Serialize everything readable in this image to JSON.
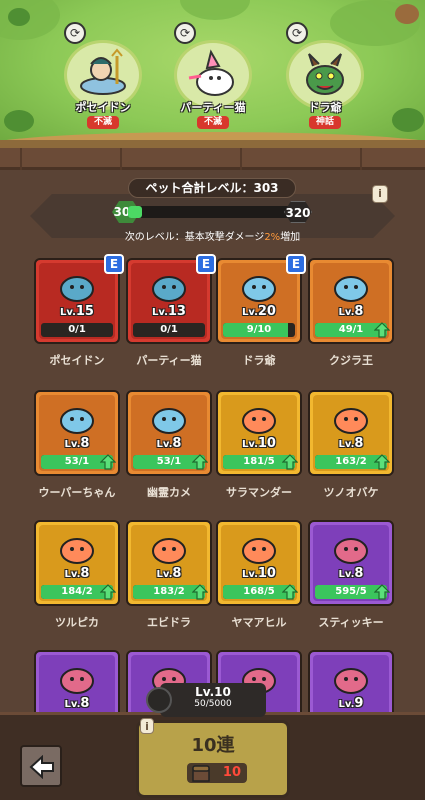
{
  "team": [
    {
      "name": "ポセイドン",
      "tag": "不滅",
      "tag_color": "#d8382c"
    },
    {
      "name": "パーティー猫",
      "tag": "不滅",
      "tag_color": "#d8382c"
    },
    {
      "name": "ドラ爺",
      "tag": "神話",
      "tag_color": "#d8382c"
    }
  ],
  "pet_level": {
    "title": "ペット合計レベル：303",
    "current": "300",
    "next": "320",
    "progress": 0.08,
    "next_bonus_prefix": "次のレベル：基本攻撃ダメージ",
    "next_bonus_value": "2%",
    "next_bonus_suffix": "増加",
    "info": "i"
  },
  "pets": [
    {
      "name": "ポセイドン",
      "level": "15",
      "count": "0/1",
      "progress": 0.0,
      "rarity": "red",
      "equipped": true,
      "upgradable": false
    },
    {
      "name": "パーティー猫",
      "level": "13",
      "count": "0/1",
      "progress": 0.0,
      "rarity": "red",
      "equipped": true,
      "upgradable": false
    },
    {
      "name": "ドラ爺",
      "level": "20",
      "count": "9/10",
      "progress": 0.9,
      "rarity": "orange",
      "equipped": true,
      "upgradable": false
    },
    {
      "name": "クジラ王",
      "level": "8",
      "count": "49/1",
      "progress": 1.0,
      "rarity": "orange",
      "equipped": false,
      "upgradable": true
    },
    {
      "name": "ウーパーちゃん",
      "level": "8",
      "count": "53/1",
      "progress": 1.0,
      "rarity": "orange",
      "equipped": false,
      "upgradable": true
    },
    {
      "name": "幽霊カメ",
      "level": "8",
      "count": "53/1",
      "progress": 1.0,
      "rarity": "orange",
      "equipped": false,
      "upgradable": true
    },
    {
      "name": "サラマンダー",
      "level": "10",
      "count": "181/5",
      "progress": 1.0,
      "rarity": "yellow",
      "equipped": false,
      "upgradable": true
    },
    {
      "name": "ツノオバケ",
      "level": "8",
      "count": "163/2",
      "progress": 1.0,
      "rarity": "yellow",
      "equipped": false,
      "upgradable": true
    },
    {
      "name": "ツルピカ",
      "level": "8",
      "count": "184/2",
      "progress": 1.0,
      "rarity": "yellow",
      "equipped": false,
      "upgradable": true
    },
    {
      "name": "エビドラ",
      "level": "8",
      "count": "183/2",
      "progress": 1.0,
      "rarity": "yellow",
      "equipped": false,
      "upgradable": true
    },
    {
      "name": "ヤマアヒル",
      "level": "10",
      "count": "168/5",
      "progress": 1.0,
      "rarity": "yellow",
      "equipped": false,
      "upgradable": true
    },
    {
      "name": "スティッキー",
      "level": "8",
      "count": "595/5",
      "progress": 1.0,
      "rarity": "purple",
      "equipped": false,
      "upgradable": true
    },
    {
      "name": "",
      "level": "8",
      "count": "",
      "progress": 0,
      "rarity": "purple",
      "equipped": false,
      "upgradable": false
    },
    {
      "name": "",
      "level": "",
      "count": "",
      "progress": 0,
      "rarity": "purple",
      "equipped": false,
      "upgradable": false
    },
    {
      "name": "",
      "level": "",
      "count": "",
      "progress": 0,
      "rarity": "purple",
      "equipped": false,
      "upgradable": false
    },
    {
      "name": "",
      "level": "9",
      "count": "",
      "progress": 0,
      "rarity": "purple",
      "equipped": false,
      "upgradable": false
    }
  ],
  "equip_badge": "E",
  "level_prefix": "Lv.",
  "gacha": {
    "level": "Lv.10",
    "exp": "50/5000",
    "button_label": "10連",
    "cost": "10",
    "info": "i"
  },
  "colors": {
    "red": "#d53a2f",
    "orange": "#e88a32",
    "yellow": "#f2b830",
    "purple": "#9b5ad3",
    "progress": "#3bc55d"
  }
}
